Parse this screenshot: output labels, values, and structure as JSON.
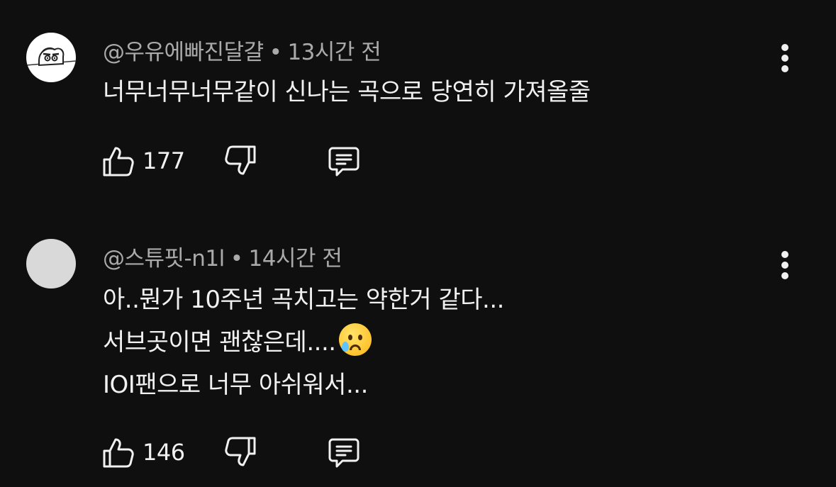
{
  "comments": [
    {
      "author": "@우유에빠진달걀",
      "separator": "•",
      "time": "13시간 전",
      "lines": [
        "너무너무너무같이 신나는 곡으로 당연히 가져올줄"
      ],
      "likes": "177",
      "avatar_icon": "crayon-shinchan-icon"
    },
    {
      "author": "@스튜핏-n1l",
      "separator": "•",
      "time": "14시간 전",
      "lines": [
        "아..뭔가 10주년 곡치고는 약한거 같다...",
        "서브곳이면 괜찮은데....",
        "IOI팬으로 너무 아쉬워서..."
      ],
      "likes": "146",
      "emoji": "crying-face-icon"
    }
  ],
  "colors": {
    "background": "#0f0f0f",
    "text": "#f1f1f1",
    "meta": "#aaaaaa"
  }
}
